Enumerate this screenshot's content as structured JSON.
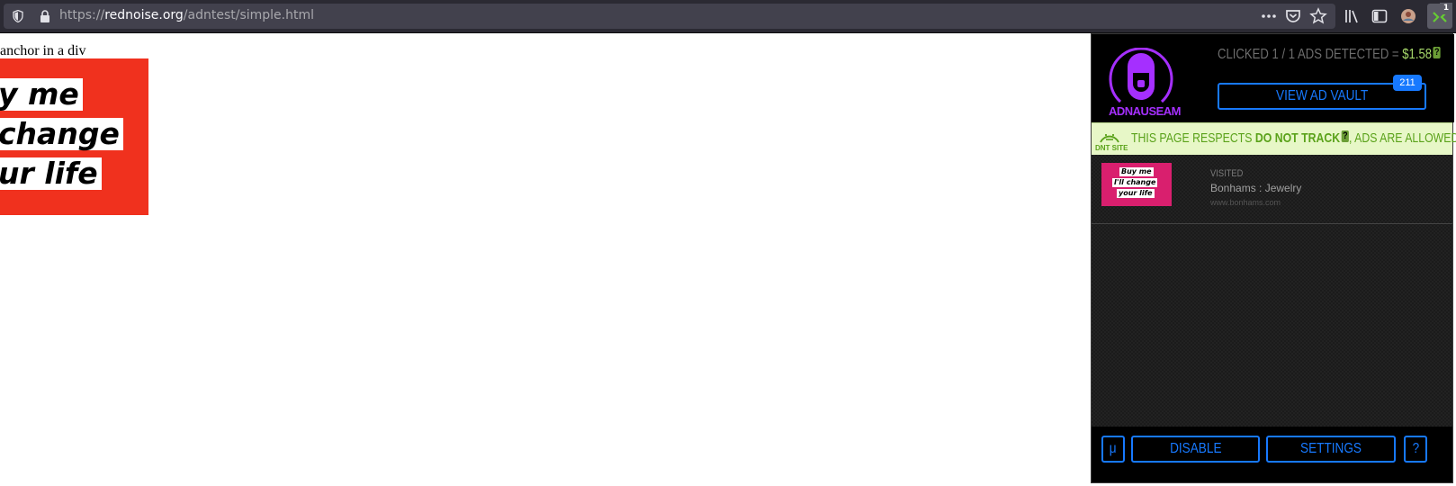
{
  "browser": {
    "url_scheme": "https://",
    "url_host": "rednoise.org",
    "url_path": "/adntest/simple.html",
    "toolbar_icons": [
      "shield-icon",
      "lock-icon",
      "more-icon",
      "pocket-icon",
      "bookmark-star-icon",
      "library-icon",
      "sidebar-icon",
      "account-icon",
      "adnauseam-extension-icon"
    ],
    "extension_badge": "1"
  },
  "page": {
    "text": "anchor in a div",
    "ad_banner_lines": [
      "y me",
      "change",
      "ur life"
    ],
    "ad_banner_color": "#f0311e"
  },
  "popup": {
    "logo_text": "ADNAUSEAM",
    "clicked_prefix": "CLICKED 1 / 1 ADS DETECTED = ",
    "cost": "$1.58",
    "help_mark": "?",
    "vault_label": "VIEW AD VAULT",
    "vault_count": "211",
    "dnt": {
      "site_label": "DNT SITE",
      "text_before": "THIS PAGE RESPECTS ",
      "text_bold": "DO NOT TRACK",
      "help_mark": "?",
      "text_after": ", ADS ARE ALLOWED."
    },
    "ads": [
      {
        "status": "VISITED",
        "title": "Bonhams : Jewelry",
        "domain": "www.bonhams.com",
        "thumb_lines": [
          "Buy me",
          "I'll change",
          "your life"
        ]
      }
    ],
    "footer": {
      "mu_label": "μ",
      "disable_label": "DISABLE",
      "settings_label": "SETTINGS",
      "help_label": "?"
    },
    "colors": {
      "accent_blue": "#1779ff",
      "logo_purple": "#a52fff",
      "dnt_green": "#5aa21a",
      "cost_green": "#a6d86a"
    }
  }
}
